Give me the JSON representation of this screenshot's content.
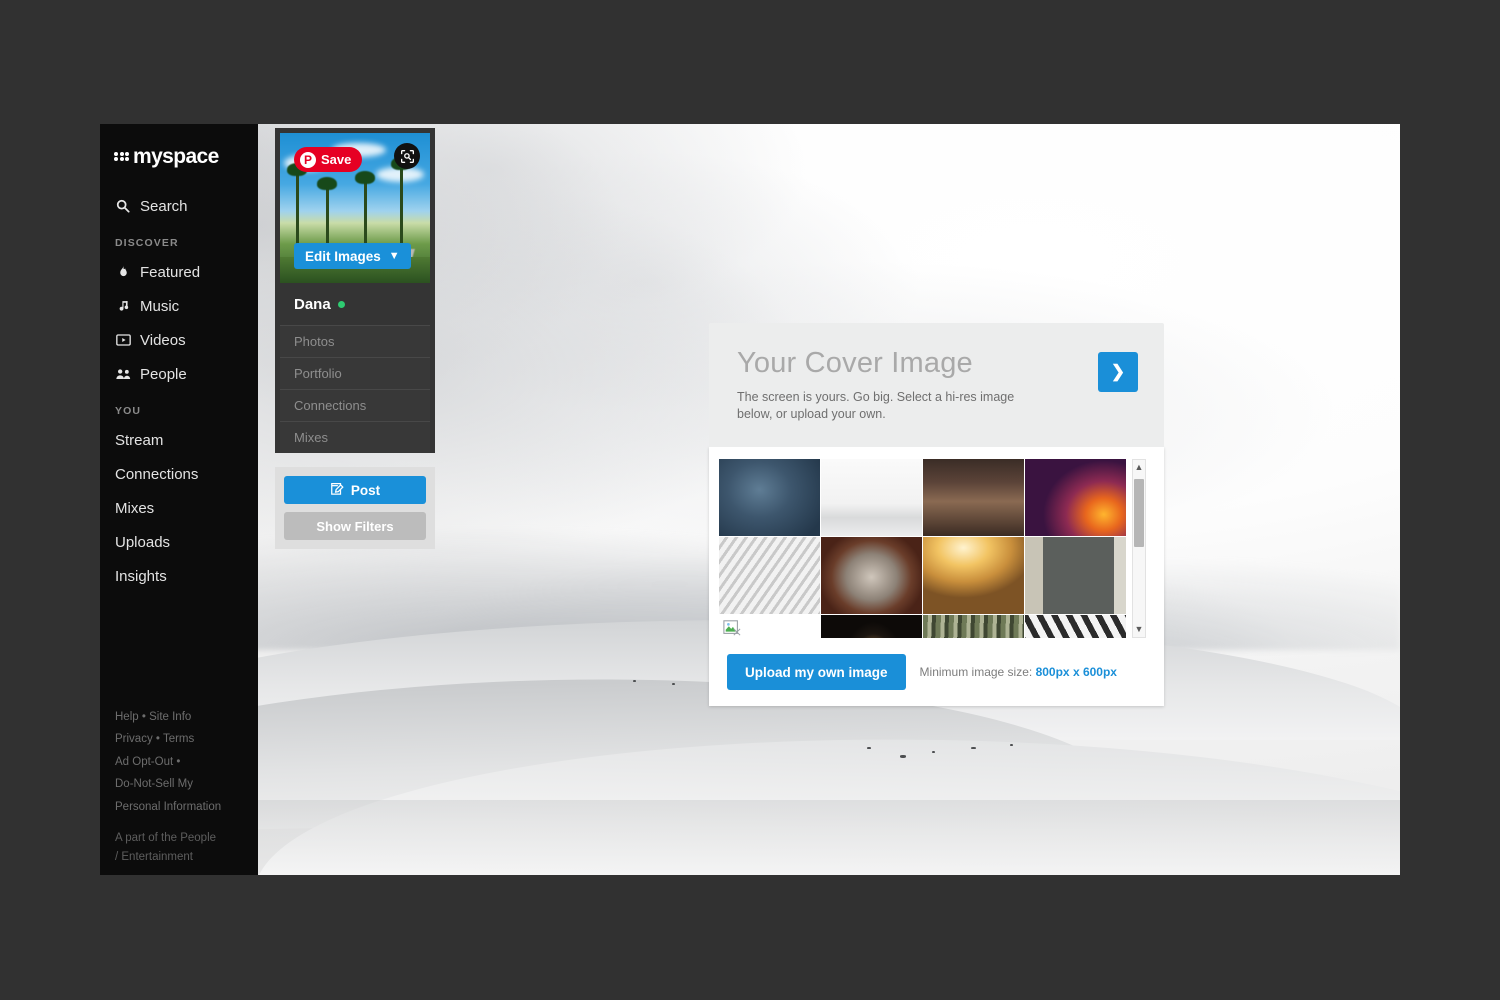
{
  "sidebar": {
    "logo_text": "myspace",
    "search": {
      "label": "Search",
      "icon": "search-icon"
    },
    "discover_label": "DISCOVER",
    "discover_items": [
      {
        "label": "Featured",
        "icon": "flame-icon"
      },
      {
        "label": "Music",
        "icon": "music-note-icon"
      },
      {
        "label": "Videos",
        "icon": "video-icon"
      },
      {
        "label": "People",
        "icon": "people-icon"
      }
    ],
    "you_label": "YOU",
    "you_items": [
      {
        "label": "Stream"
      },
      {
        "label": "Connections"
      },
      {
        "label": "Mixes"
      },
      {
        "label": "Uploads"
      },
      {
        "label": "Insights"
      }
    ],
    "footer": {
      "line1_a": "Help",
      "line1_sep": "•",
      "line1_b": "Site Info",
      "line2_a": "Privacy",
      "line2_sep": "•",
      "line2_b": "Terms",
      "line3_a": "Ad Opt-Out",
      "line3_sep": "•",
      "line4": "Do-Not-Sell My",
      "line5": "Personal Information",
      "note_line1": "A part of the People",
      "note_line2": "/ Entertainment"
    }
  },
  "profile": {
    "pinterest_save": {
      "label": "Save",
      "badge": "P",
      "color": "#e60023"
    },
    "lens_icon": "visual-search-icon",
    "edit_images_label": "Edit Images",
    "name": "Dana",
    "online": true,
    "nav": [
      {
        "label": "Photos"
      },
      {
        "label": "Portfolio"
      },
      {
        "label": "Connections"
      },
      {
        "label": "Mixes"
      }
    ],
    "post_label": "Post",
    "show_filters_label": "Show Filters"
  },
  "cover_dialog": {
    "title": "Your Cover Image",
    "subtitle": "The screen is yours. Go big. Select a hi-res image below, or upload your own.",
    "next_icon": "chevron-right-icon",
    "upload_label": "Upload my own image",
    "min_size_prefix": "Minimum image size:",
    "min_size_value": "800px x 600px",
    "accent_color": "#1a8fd8",
    "scrollbar": {
      "up_icon": "caret-up-icon",
      "down_icon": "caret-down-icon"
    },
    "thumbnails": [
      {
        "name": "blue-ice-texture",
        "broken": false
      },
      {
        "name": "white-snow-landscape",
        "broken": false
      },
      {
        "name": "vintage-workbench",
        "broken": false
      },
      {
        "name": "purple-fire-sparks",
        "broken": false
      },
      {
        "name": "grayscale-structure",
        "broken": false
      },
      {
        "name": "drum-with-sticks",
        "broken": false
      },
      {
        "name": "golden-cattle-herd",
        "broken": false
      },
      {
        "name": "concrete-building",
        "broken": false
      },
      {
        "name": "broken-image-placeholder",
        "broken": true
      },
      {
        "name": "dark-doorway-light",
        "broken": false
      },
      {
        "name": "green-reeds",
        "broken": false
      },
      {
        "name": "white-stripes-angles",
        "broken": false
      }
    ]
  }
}
